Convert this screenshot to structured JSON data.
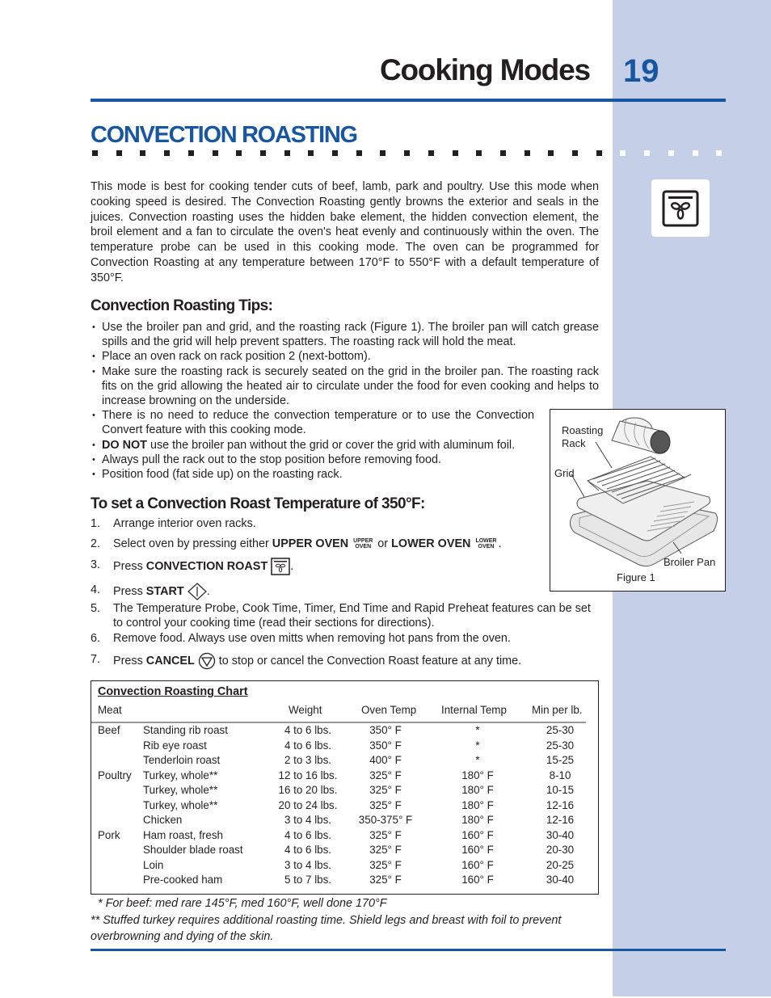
{
  "header": {
    "chapter_title": "Cooking Modes",
    "page_number": "19"
  },
  "section": {
    "title": "CONVECTION ROASTING",
    "mode_icon": "convection-roast-fan-icon"
  },
  "intro": "This mode is best for cooking tender cuts of beef, lamb, park and poultry. Use this mode when cooking speed is desired. The Convection Roasting gently browns the exterior and seals in the juices. Convection roasting uses the hidden bake element, the hidden convection element, the broil element and a fan to circulate the oven's heat evenly and continuously within the oven. The temperature probe can be used in this cooking mode. The oven can be programmed for Convection Roasting at any temperature between 170°F to 550°F with a default temperature of 350°F.",
  "tips": {
    "heading": "Convection Roasting Tips:",
    "items": [
      {
        "bold": "",
        "text": "Use the broiler pan and grid, and the roasting rack (Figure 1). The broiler pan will catch grease spills and the grid will help prevent spatters. The roasting rack will hold the meat."
      },
      {
        "bold": "",
        "text": "Place an oven rack on rack position 2 (next-bottom)."
      },
      {
        "bold": "",
        "text": "Make sure the roasting rack is securely seated on the grid in the broiler pan. The roasting rack fits on the grid allowing the heated air to circulate under the food for even cooking and helps to increase browning on the underside."
      },
      {
        "bold": "",
        "text": "There is no need to reduce the convection temperature or to use the Convection Convert feature with this cooking mode."
      },
      {
        "bold": "DO NOT",
        "text": " use the broiler pan without the grid or cover the grid with aluminum foil."
      },
      {
        "bold": "",
        "text": "Always pull the rack out to the stop position before removing food."
      },
      {
        "bold": "",
        "text": "Position food (fat side up) on the roasting rack."
      }
    ]
  },
  "figure": {
    "labels": {
      "roasting_rack_1": "Roasting",
      "roasting_rack_2": "Rack",
      "grid": "Grid",
      "broiler_pan": "Broiler Pan"
    },
    "caption": "Figure 1"
  },
  "steps": {
    "heading": "To set a Convection Roast Temperature of 350°F:",
    "items": [
      {
        "num": "1.",
        "text": "Arrange interior oven racks."
      },
      {
        "num": "2.",
        "pre": "Select oven by pressing either ",
        "key1": "UPPER OVEN",
        "key1_icon_top": "UPPER",
        "key1_icon_bottom": "OVEN",
        "mid": " or ",
        "key2": "LOWER OVEN",
        "key2_icon_top": "LOWER",
        "key2_icon_bottom": "OVEN",
        "post": "."
      },
      {
        "num": "3.",
        "pre": "Press ",
        "key": "CONVECTION ROAST",
        "icon": "convection-roast-key-icon",
        "post": "."
      },
      {
        "num": "4.",
        "pre": "Press ",
        "key": "START",
        "icon": "start-diamond-icon",
        "post": "."
      },
      {
        "num": "5.",
        "text": "The Temperature Probe, Cook Time, Timer, End Time and Rapid Preheat features can be set to control your cooking time (read their sections for directions)."
      },
      {
        "num": "6.",
        "text": "Remove food. Always use oven mitts when removing hot pans from the oven."
      },
      {
        "num": "7.",
        "pre": "Press ",
        "key": "CANCEL",
        "icon": "cancel-triangle-icon",
        "post": " to stop or cancel the Convection Roast feature at any time."
      }
    ]
  },
  "chart_data": {
    "type": "table",
    "title": "Convection Roasting Chart",
    "columns": [
      "Meat",
      "",
      "Weight",
      "Oven Temp",
      "Internal Temp",
      "Min per lb."
    ],
    "rows": [
      [
        "Beef",
        "Standing rib roast",
        "4 to 6 lbs.",
        "350° F",
        "*",
        "25-30"
      ],
      [
        "",
        "Rib eye roast",
        "4 to 6 lbs.",
        "350° F",
        "*",
        "25-30"
      ],
      [
        "",
        "Tenderloin roast",
        "2 to 3 lbs.",
        "400° F",
        "*",
        "15-25"
      ],
      [
        "Poultry",
        "Turkey, whole**",
        "12 to 16 lbs.",
        "325° F",
        "180° F",
        "8-10"
      ],
      [
        "",
        "Turkey, whole**",
        "16 to 20 lbs.",
        "325° F",
        "180° F",
        "10-15"
      ],
      [
        "",
        "Turkey, whole**",
        "20 to 24 lbs.",
        "325° F",
        "180° F",
        "12-16"
      ],
      [
        "",
        "Chicken",
        "3 to 4 lbs.",
        "350-375° F",
        "180° F",
        "12-16"
      ],
      [
        "Pork",
        "Ham roast, fresh",
        "4 to 6 lbs.",
        "325° F",
        "160° F",
        "30-40"
      ],
      [
        "",
        "Shoulder blade roast",
        "4 to 6 lbs.",
        "325° F",
        "160° F",
        "20-30"
      ],
      [
        "",
        "Loin",
        "3 to 4 lbs.",
        "325° F",
        "160° F",
        "20-25"
      ],
      [
        "",
        "Pre-cooked ham",
        "5 to 7 lbs.",
        "325° F",
        "160° F",
        "30-40"
      ]
    ]
  },
  "footnotes": {
    "one": "* For beef: med rare 145°F, med 160°F, well done 170°F",
    "two": "** Stuffed turkey requires additional roasting time. Shield legs and breast with foil to prevent overbrowning and dying of the skin."
  },
  "colors": {
    "accent_blue": "#1756a0",
    "sidebar": "#c5cfe8",
    "text": "#231f20"
  }
}
